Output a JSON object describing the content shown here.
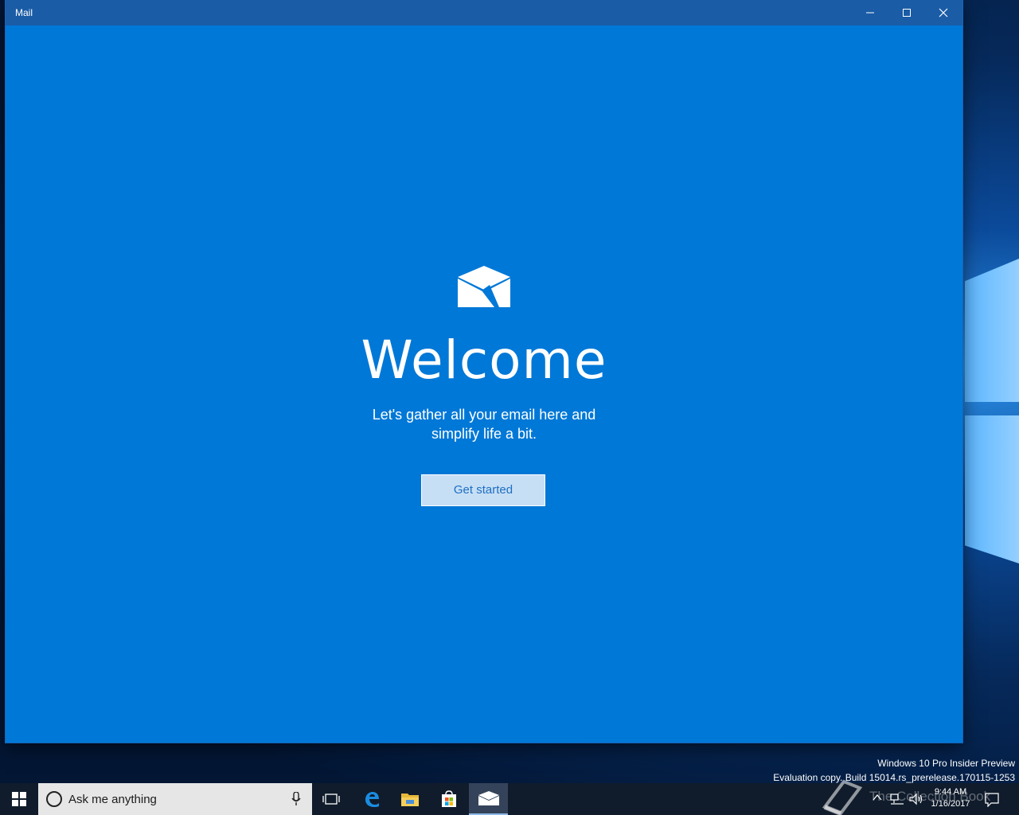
{
  "window": {
    "title": "Mail",
    "accent_color": "#0078d7",
    "titlebar_color": "#1a5ca6"
  },
  "welcome": {
    "heading": "Welcome",
    "subtitle_line1": "Let's gather all your email here and",
    "subtitle_line2": "simplify life a bit.",
    "button_label": "Get started"
  },
  "watermark": {
    "line1": "Windows 10 Pro Insider Preview",
    "line2": "Evaluation copy. Build 15014.rs_prerelease.170115-1253"
  },
  "taskbar": {
    "search_placeholder": "Ask me anything",
    "apps": [
      "start-icon",
      "task-view-icon",
      "edge-icon",
      "file-explorer-icon",
      "store-icon",
      "mail-icon"
    ],
    "brand_overlay": "The Collection Book",
    "time": "9:44 AM",
    "date": "1/16/2017"
  }
}
